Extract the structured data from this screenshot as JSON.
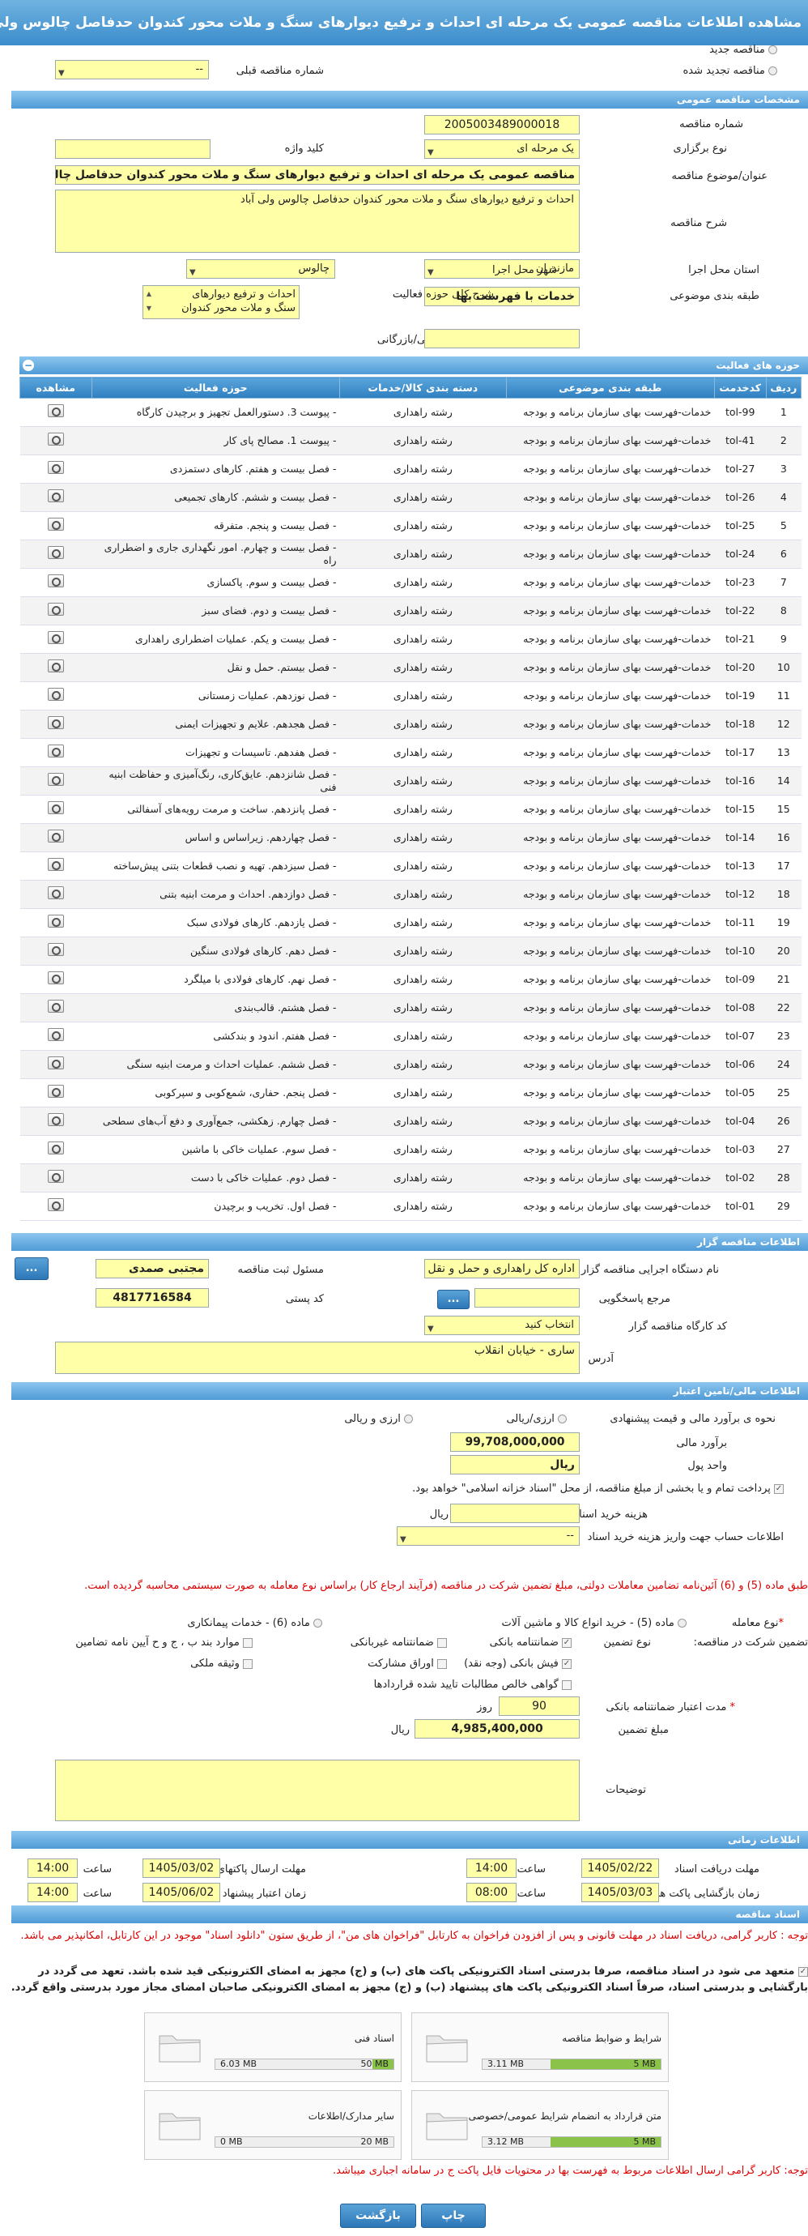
{
  "title": "مشاهده اطلاعات مناقصه عمومی یک مرحله ای احداث و ترفیع دیوارهای سنگ و ملات محور کندوان حدفاصل چالوس ولی آباد",
  "top": {
    "radio_new": "مناقصه جدید",
    "radio_renew": "مناقصه تجدید شده",
    "prev_label": "شماره مناقصه قبلی",
    "prev_value": "--"
  },
  "sections": {
    "general": "مشخصات مناقصه عمومی",
    "activities": "حوزه های فعالیت",
    "organizer": "اطلاعات مناقصه گزار",
    "financial": "اطلاعات مالی/تامین اعتبار",
    "timing": "اطلاعات زمانی",
    "docs": "اسناد مناقصه"
  },
  "general": {
    "number_label": "شماره مناقصه",
    "number": "2005003489000018",
    "type_label": "نوع برگزاری",
    "type": "یک مرحله ای",
    "keyword_label": "کلید واژه",
    "keyword": "",
    "subject_label": "عنوان/موضوع مناقصه",
    "subject": "مناقصه عمومی یک مرحله ای احداث و ترفیع دیوارهای سنگ و ملات محور کندوان حدفاصل چالوس ولی آباد",
    "desc_label": "شرح مناقصه",
    "desc": "احداث و ترفیع دیوارهای سنگ و ملات محور کندوان حدفاصل چالوس  ولی آباد",
    "province_label": "استان محل اجرا",
    "province": "مازندران",
    "city_label": "شهر محل اجرا",
    "city": "چالوس",
    "classify_label": "طبقه بندی موضوعی",
    "classify": "خدمات با فهرست بها",
    "scope_label": "شرح کلی حوزه فعالیت",
    "scope_line1": "احداث و ترفیع دیوارهای",
    "scope_line2": "سنگ و ملات محور کندوان",
    "minscore_label": "حداقل امتیاز قابل قبول ارزیابی فنی/بازرگانی",
    "minscore": ""
  },
  "table": {
    "headers": [
      "ردیف",
      "کدخدمت",
      "طبقه بندی موضوعی",
      "دسته بندی کالا/خدمات",
      "حوزه فعالیت",
      "مشاهده"
    ],
    "rows": [
      [
        "1",
        "tol-99",
        "خدمات-فهرست بهای سازمان برنامه و بودجه",
        "رشته راهداری",
        "- پیوست 3. دستورالعمل تجهیز و برچیدن کارگاه"
      ],
      [
        "2",
        "tol-41",
        "خدمات-فهرست بهای سازمان برنامه و بودجه",
        "رشته راهداری",
        "- پیوست 1. مصالح پای کار"
      ],
      [
        "3",
        "tol-27",
        "خدمات-فهرست بهای سازمان برنامه و بودجه",
        "رشته راهداری",
        "- فصل بیست و هفتم. کارهای دستمزدی"
      ],
      [
        "4",
        "tol-26",
        "خدمات-فهرست بهای سازمان برنامه و بودجه",
        "رشته راهداری",
        "- فصل بیست و ششم. کارهای تجمیعی"
      ],
      [
        "5",
        "tol-25",
        "خدمات-فهرست بهای سازمان برنامه و بودجه",
        "رشته راهداری",
        "- فصل بیست و پنجم. متفرقه"
      ],
      [
        "6",
        "tol-24",
        "خدمات-فهرست بهای سازمان برنامه و بودجه",
        "رشته راهداری",
        "- فصل بیست و چهارم. امور نگهداری جاری و اضطراری راه"
      ],
      [
        "7",
        "tol-23",
        "خدمات-فهرست بهای سازمان برنامه و بودجه",
        "رشته راهداری",
        "- فصل بیست و سوم. پاکسازی"
      ],
      [
        "8",
        "tol-22",
        "خدمات-فهرست بهای سازمان برنامه و بودجه",
        "رشته راهداری",
        "- فصل بیست و دوم. فضای سبز"
      ],
      [
        "9",
        "tol-21",
        "خدمات-فهرست بهای سازمان برنامه و بودجه",
        "رشته راهداری",
        "- فصل بیست و یکم. عملیات اضطراری راهداری"
      ],
      [
        "10",
        "tol-20",
        "خدمات-فهرست بهای سازمان برنامه و بودجه",
        "رشته راهداری",
        "- فصل بیستم. حمل و نقل"
      ],
      [
        "11",
        "tol-19",
        "خدمات-فهرست بهای سازمان برنامه و بودجه",
        "رشته راهداری",
        "- فصل نوزدهم. عملیات زمستانی"
      ],
      [
        "12",
        "tol-18",
        "خدمات-فهرست بهای سازمان برنامه و بودجه",
        "رشته راهداری",
        "- فصل هجدهم. علایم و تجهیزات ایمنی"
      ],
      [
        "13",
        "tol-17",
        "خدمات-فهرست بهای سازمان برنامه و بودجه",
        "رشته راهداری",
        "- فصل هفدهم. تاسیسات و تجهیزات"
      ],
      [
        "14",
        "tol-16",
        "خدمات-فهرست بهای سازمان برنامه و بودجه",
        "رشته راهداری",
        "- فصل شانزدهم. عایق‌کاری، رنگ‌آمیزی و حفاظت ابنیه فنی"
      ],
      [
        "15",
        "tol-15",
        "خدمات-فهرست بهای سازمان برنامه و بودجه",
        "رشته راهداری",
        "- فصل پانزدهم. ساخت و مرمت رویه‌های آسفالتی"
      ],
      [
        "16",
        "tol-14",
        "خدمات-فهرست بهای سازمان برنامه و بودجه",
        "رشته راهداری",
        "- فصل چهاردهم. زیراساس و اساس"
      ],
      [
        "17",
        "tol-13",
        "خدمات-فهرست بهای سازمان برنامه و بودجه",
        "رشته راهداری",
        "- فصل سیزدهم. تهیه و نصب قطعات بتنی پیش‌ساخته"
      ],
      [
        "18",
        "tol-12",
        "خدمات-فهرست بهای سازمان برنامه و بودجه",
        "رشته راهداری",
        "- فصل دوازدهم. احداث و مرمت ابنیه بتنی"
      ],
      [
        "19",
        "tol-11",
        "خدمات-فهرست بهای سازمان برنامه و بودجه",
        "رشته راهداری",
        "- فصل یازدهم. کارهای فولادی سبک"
      ],
      [
        "20",
        "tol-10",
        "خدمات-فهرست بهای سازمان برنامه و بودجه",
        "رشته راهداری",
        "- فصل دهم. کارهای فولادی سنگین"
      ],
      [
        "21",
        "tol-09",
        "خدمات-فهرست بهای سازمان برنامه و بودجه",
        "رشته راهداری",
        "- فصل نهم. کارهای فولادی با میلگرد"
      ],
      [
        "22",
        "tol-08",
        "خدمات-فهرست بهای سازمان برنامه و بودجه",
        "رشته راهداری",
        "- فصل هشتم. قالب‌بندی"
      ],
      [
        "23",
        "tol-07",
        "خدمات-فهرست بهای سازمان برنامه و بودجه",
        "رشته راهداری",
        "- فصل هفتم. اندود و بندکشی"
      ],
      [
        "24",
        "tol-06",
        "خدمات-فهرست بهای سازمان برنامه و بودجه",
        "رشته راهداری",
        "- فصل ششم.  عملیات احداث و مرمت ابنیه سنگی"
      ],
      [
        "25",
        "tol-05",
        "خدمات-فهرست بهای سازمان برنامه و بودجه",
        "رشته راهداری",
        "- فصل پنجم. حفاری، شمع‌کوبی و سپرکوبی"
      ],
      [
        "26",
        "tol-04",
        "خدمات-فهرست بهای سازمان برنامه و بودجه",
        "رشته راهداری",
        "- فصل چهارم. زهکشی، جمع‌آوری و دفع آب‌های سطحی"
      ],
      [
        "27",
        "tol-03",
        "خدمات-فهرست بهای سازمان برنامه و بودجه",
        "رشته راهداری",
        "- فصل سوم. عملیات خاکی با ماشین"
      ],
      [
        "28",
        "tol-02",
        "خدمات-فهرست بهای سازمان برنامه و بودجه",
        "رشته راهداری",
        "- فصل دوم. عملیات خاکی با دست"
      ],
      [
        "29",
        "tol-01",
        "خدمات-فهرست بهای سازمان برنامه و بودجه",
        "رشته راهداری",
        "- فصل اول. تخریب و برچیدن"
      ]
    ]
  },
  "organizer": {
    "device_label": "نام دستگاه اجرایی مناقصه گزار",
    "device": "اداره کل راهداری و حمل و نقل جاده ای استان مازندران",
    "registrar_label": "مسئول ثبت مناقصه",
    "registrar": "مجتبی صمدی",
    "ref_label": "مرجع پاسخگویی",
    "ref": "",
    "postal_label": "کد پستی",
    "postal": "4817716584",
    "workshop_label": "کد کارگاه مناقصه گزار",
    "workshop": "انتخاب کنید",
    "address_label": "آدرس",
    "address": "ساری - خیابان  انقلاب",
    "btn_more": "...",
    "btn_ref": "..."
  },
  "financial": {
    "estimate_label": "نحوه ی برآورد مالی و قیمت پیشنهادی",
    "opt_rial": "ارزی/ریالی",
    "opt_fx": "ارزی و ریالی",
    "amount_label": "برآورد مالی",
    "amount": "99,708,000,000",
    "unit_label": "واحد پول",
    "unit": "ریال",
    "treasury_note": "پرداخت تمام و یا بخشی از مبلغ مناقصه، از محل \"اسناد خزانه اسلامی\" خواهد بود.",
    "doc_cost_label": "هزینه خرید اسناد",
    "doc_cost_unit": "ریال",
    "account_label": "اطلاعات حساب جهت واریز هزینه خرید اسناد",
    "account": "--",
    "note_red": "طبق ماده (5) و (6) آئین‌نامه تضامین معاملات دولتی، مبلغ تضمین شرکت در مناقصه (فرآیند ارجاع کار) براساس نوع معامله به صورت سیستمی محاسبه گردیده است.",
    "deal_type_label": "نوع معامله",
    "deal_opt1": "ماده (5) - خرید انواع کالا و ماشین آلات",
    "deal_opt2": "ماده (6) - خدمات پیمانکاری",
    "guarantee_label": "تضمین شرکت در مناقصه:",
    "guarantee_type_label": "نوع تضمین",
    "g1": "ضمانتنامه بانکی",
    "g2": "ضمانتنامه غیربانکی",
    "g3": "موارد بند ب ، ج و ح آیین نامه تضامین",
    "g4": "فیش بانکی (وجه نقد)",
    "g5": "اوراق مشارکت",
    "g6": "وثیقه ملکی",
    "g7": "گواهی خالص مطالبات تایید شده قراردادها",
    "validity_label": "مدت اعتبار ضمانتنامه بانکی",
    "validity": "90",
    "validity_unit": "روز",
    "amount_g_label": "مبلغ تضمین",
    "amount_g": "4,985,400,000",
    "amount_g_unit": "ریال",
    "notes_label": "توضیحات",
    "notes": ""
  },
  "timing": {
    "receive_label": "مهلت دریافت اسناد",
    "receive_date": "1405/02/22",
    "receive_time_label": "ساعت",
    "receive_time": "14:00",
    "send_label": "مهلت ارسال پاکتهای پیشنهاد",
    "send_date": "1405/03/02",
    "send_time_label": "ساعت",
    "send_time": "14:00",
    "open_label": "زمان بازگشایی پاکت ها",
    "open_date": "1405/03/03",
    "open_time_label": "ساعت",
    "open_time": "08:00",
    "valid_label": "زمان اعتبار پیشنهاد",
    "valid_date": "1405/06/02",
    "valid_time_label": "ساعت",
    "valid_time": "14:00"
  },
  "docs": {
    "warn1": "توجه : کاربر گرامی، دریافت اسناد در مهلت قانونی و پس از افزودن فراخوان به کارتابل \"فراخوان های من\"، از طریق ستون \"دانلود اسناد\" موجود در این کارتابل، امکانپذیر می باشد.",
    "warn2": "متعهد می شود در اسناد مناقصه، صرفا بدرستی اسناد الکترونیکی پاکت های (ب) و (ج) مجهز به امضای الکترونیکی قید شده باشد. تعهد می گردد در بارگشایی و بدرستی اسناد، صرفاً اسناد الکترونیکی پاکت های پیشنهاد (ب) و (ج) مجهز به امضای الکترونیکی صاحبان امضای مجاز مورد بدرستی واقع گردد.",
    "files": [
      {
        "name": "شرایط و ضوابط مناقصه",
        "used": "3.11 MB",
        "max": "5 MB",
        "frac": 0.62
      },
      {
        "name": "اسناد فنی",
        "used": "6.03 MB",
        "max": "50 MB",
        "frac": 0.12
      },
      {
        "name": "متن قرارداد به انضمام شرایط عمومی/خصوصی",
        "used": "3.12 MB",
        "max": "5 MB",
        "frac": 0.62
      },
      {
        "name": "سایر مدارک/اطلاعات",
        "used": "0 MB",
        "max": "20 MB",
        "frac": 0
      }
    ],
    "warn3": "توجه: کاربر گرامی ارسال اطلاعات مربوط به فهرست بها در محتویات فایل پاکت ج در سامانه اجباری میباشد."
  },
  "buttons": {
    "print": "چاپ",
    "back": "بازگشت"
  }
}
